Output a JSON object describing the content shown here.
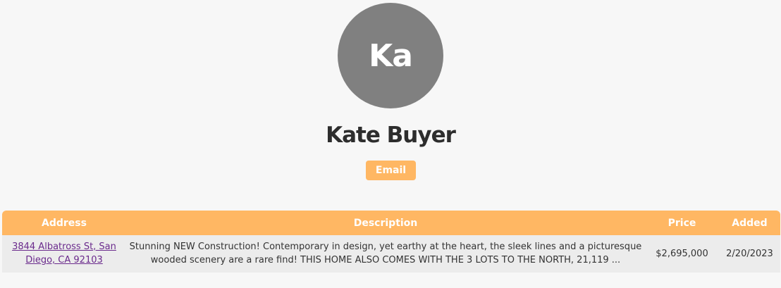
{
  "profile": {
    "initials": "Ka",
    "name": "Kate Buyer",
    "email_button": "Email"
  },
  "table": {
    "headers": {
      "address": "Address",
      "description": "Description",
      "price": "Price",
      "added": "Added"
    },
    "rows": [
      {
        "address": "3844 Albatross St, San Diego, CA 92103",
        "description": "Stunning NEW Construction! Contemporary in design, yet earthy at the heart, the sleek lines and a picturesque wooded scenery are a rare find! THIS HOME ALSO COMES WITH THE 3 LOTS TO THE NORTH, 21,119 ...",
        "price": "$2,695,000",
        "added": "2/20/2023"
      }
    ]
  },
  "colors": {
    "accent": "#ffb763",
    "avatar_bg": "#808080",
    "link": "#6a2a8c",
    "row_bg": "#ececec",
    "page_bg": "#f7f7f7"
  }
}
